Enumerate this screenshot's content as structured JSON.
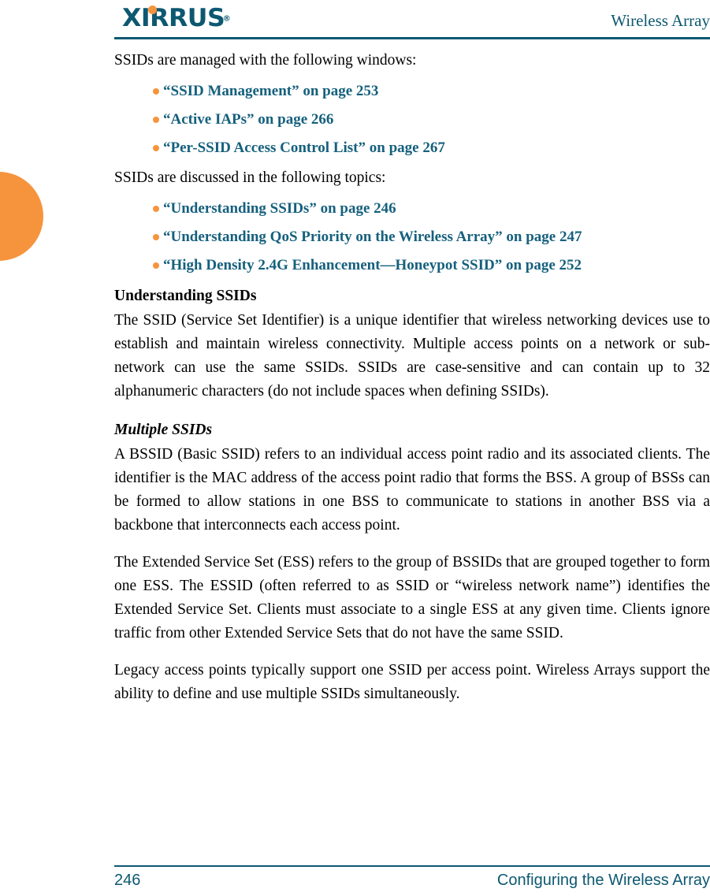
{
  "header": {
    "logo_text": "XIRRUS",
    "logo_trademark": "®",
    "title": "Wireless Array"
  },
  "content": {
    "intro_windows": "SSIDs are managed with the following windows:",
    "windows_links": [
      {
        "label": "“SSID Management” on page 253"
      },
      {
        "label": "“Active IAPs” on page 266"
      },
      {
        "label": "“Per-SSID Access Control List” on page 267"
      }
    ],
    "intro_topics": "SSIDs are discussed in the following topics:",
    "topics_links": [
      {
        "label": "“Understanding SSIDs” on page 246"
      },
      {
        "label": "“Understanding QoS Priority on the Wireless Array” on page 247"
      },
      {
        "label": "“High Density 2.4G Enhancement—Honeypot SSID” on page 252"
      }
    ],
    "section_title": "Understanding SSIDs",
    "section_paragraph": "The SSID (Service Set Identifier) is a unique identifier that wireless networking devices use to establish and maintain wireless connectivity. Multiple access points on a network or sub-network can use the same SSIDs. SSIDs are case-sensitive and can contain up to 32 alphanumeric characters (do not include spaces when defining SSIDs).",
    "sub_title": "Multiple SSIDs",
    "paragraph_bssid": "A BSSID (Basic SSID) refers to an individual access point radio and its associated clients. The identifier is the MAC address of the access point radio that forms the BSS. A group of BSSs can be formed to allow stations in one BSS to communicate to stations in another BSS via a backbone that interconnects each access point.",
    "paragraph_ess": "The Extended Service Set (ESS) refers to the group of BSSIDs that are grouped together to form one ESS. The ESSID (often referred to as SSID or “wireless network name”) identifies the Extended Service Set. Clients must associate to a single ESS at any given time. Clients ignore traffic from other Extended Service Sets that do not have the same SSID.",
    "paragraph_legacy": "Legacy access points typically support one SSID per access point. Wireless Arrays support the ability to define and use multiple SSIDs simultaneously."
  },
  "footer": {
    "page_number": "246",
    "chapter": "Configuring the Wireless Array"
  },
  "colors": {
    "teal": "#0d5871",
    "link_teal": "#15607d",
    "orange": "#f6943d"
  }
}
